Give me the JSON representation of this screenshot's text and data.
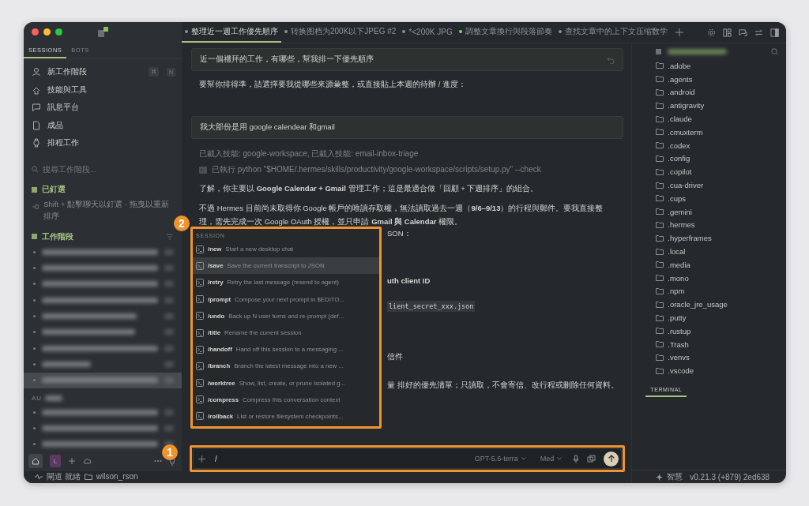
{
  "sidebar": {
    "tabs": [
      {
        "label": "SESSIONS",
        "selected": true
      },
      {
        "label": "BOTS",
        "selected": false
      }
    ],
    "nav": [
      {
        "label": "新工作階段",
        "keys": [
          "⌘",
          "N"
        ]
      },
      {
        "label": "技能與工具"
      },
      {
        "label": "訊息平台"
      },
      {
        "label": "成品"
      },
      {
        "label": "排程工作"
      }
    ],
    "search": {
      "placeholder": "搜尋工作階段..."
    },
    "pinned": {
      "title": "已釘選",
      "hint": "Shift + 點擊聊天以釘選 · 拖曳以重新排序"
    },
    "sessions_title": "工作階段",
    "sessions": [
      {
        "selected": false
      },
      {
        "selected": false
      },
      {
        "selected": false
      },
      {
        "selected": false
      },
      {
        "selected": false
      },
      {
        "selected": false
      },
      {
        "selected": false
      },
      {
        "selected": false
      },
      {
        "selected": true
      }
    ],
    "older_label": "AU",
    "older": [
      {
        "selected": false
      },
      {
        "selected": false
      },
      {
        "selected": false
      }
    ],
    "avatar": "L"
  },
  "tabs": [
    {
      "label": "整理近一週工作優先順序",
      "selected": true,
      "color": "#8a8f94"
    },
    {
      "label": "转换图档为200K以下JPEG #2",
      "selected": false,
      "color": "#8a8f94"
    },
    {
      "label": "*<200K JPG",
      "selected": false,
      "color": "#8a8f94"
    },
    {
      "label": "調整文章換行與段落節奏",
      "selected": false,
      "color": "#7ccf7a"
    },
    {
      "label": "查找文章中的上下文压缩数学",
      "selected": false,
      "color": "#8a8f94"
    }
  ],
  "chat": [
    {
      "kind": "user",
      "text": "近一個禮拜的工作，有哪些，幫我排一下優先順序"
    },
    {
      "kind": "text",
      "text": "要幫你排得準，請選擇要我從哪些來源彙整，或直接貼上本週的待辦 / 進度："
    },
    {
      "kind": "user",
      "text": "我大部份是用 google calendear 和gmail"
    },
    {
      "kind": "note",
      "text": "已載入技能: google-workspace, 已載入技能: email-inbox-triage"
    },
    {
      "kind": "tool",
      "text": "已執行 python \"$HOME/.hermes/skills/productivity/google-workspace/scripts/setup.py\" --check"
    },
    {
      "kind": "text",
      "text": "了解，你主要以 **Google Calendar + Gmail** 管理工作；這是最適合做「回顧 + 下週排序」的組合。"
    },
    {
      "kind": "text",
      "text": "不過 Hermes 目前尚未取得你 Google 帳戶的唯讀存取權，無法讀取過去一週（**9/6–9/13**）的行程與郵件。要我直接整理，需先完成一次 Google OAuth 授權，並只申請 **Gmail 與 Calendar** 權限。"
    }
  ],
  "chat_hidden_tail": [
    {
      "kind": "text",
      "text": "SON："
    },
    {
      "kind": "bold",
      "text": "uth client ID"
    },
    {
      "kind": "code",
      "text": "lient_secret_xxx.json"
    },
    {
      "kind": "text",
      "text": "信件"
    },
    {
      "kind": "text",
      "text": "量 排好的優先清單；只讀取，不會寄信、改行程或刪除任何資料。"
    }
  ],
  "palette": {
    "section": "SESSION",
    "items": [
      {
        "command": "/new",
        "description": "Start a new desktop chat",
        "selected": false
      },
      {
        "command": "/save",
        "description": "Save the current transcript to JSON",
        "selected": true
      },
      {
        "command": "/retry",
        "description": "Retry the last message (resend to agent)",
        "selected": false
      },
      {
        "command": "/prompt",
        "description": "Compose your next prompt in $EDITO...",
        "selected": false
      },
      {
        "command": "/undo",
        "description": "Back up N user turns and re-prompt (def...",
        "selected": false
      },
      {
        "command": "/title",
        "description": "Rename the current session",
        "selected": false
      },
      {
        "command": "/handoff",
        "description": "Hand off this session to a messaging ...",
        "selected": false
      },
      {
        "command": "/branch",
        "description": "Branch the latest message into a new ...",
        "selected": false
      },
      {
        "command": "/worktree",
        "description": "Show, list, create, or prune isolated g...",
        "selected": false
      },
      {
        "command": "/compress",
        "description": "Compress this conversation context",
        "selected": false
      },
      {
        "command": "/rollback",
        "description": "List or restore filesystem checkpoints...",
        "selected": false
      }
    ]
  },
  "composer": {
    "value": "/",
    "model": "GPT-5.6-terra",
    "effort": "Med"
  },
  "files": [
    ".adobe",
    ".agents",
    ".android",
    ".antigravity",
    ".claude",
    ".cmuxterm",
    ".codex",
    ".config",
    ".copilot",
    ".cua-driver",
    ".cups",
    ".gemini",
    ".hermes",
    ".hyperframes",
    ".local",
    ".media",
    ".mono",
    ".npm",
    ".oracle_jre_usage",
    ".putty",
    ".rustup",
    ".Trash",
    ".venvs",
    ".vscode"
  ],
  "right_tabs": [
    {
      "label": "TERMINAL",
      "selected": true
    }
  ],
  "status_bar": {
    "gateway": "閘道 就緒",
    "folder": "wilson_rson",
    "mode": "智慧",
    "version": "v0.21.3 (+879) 2ed638"
  },
  "annotations": [
    {
      "label": "1"
    },
    {
      "label": "2"
    }
  ]
}
